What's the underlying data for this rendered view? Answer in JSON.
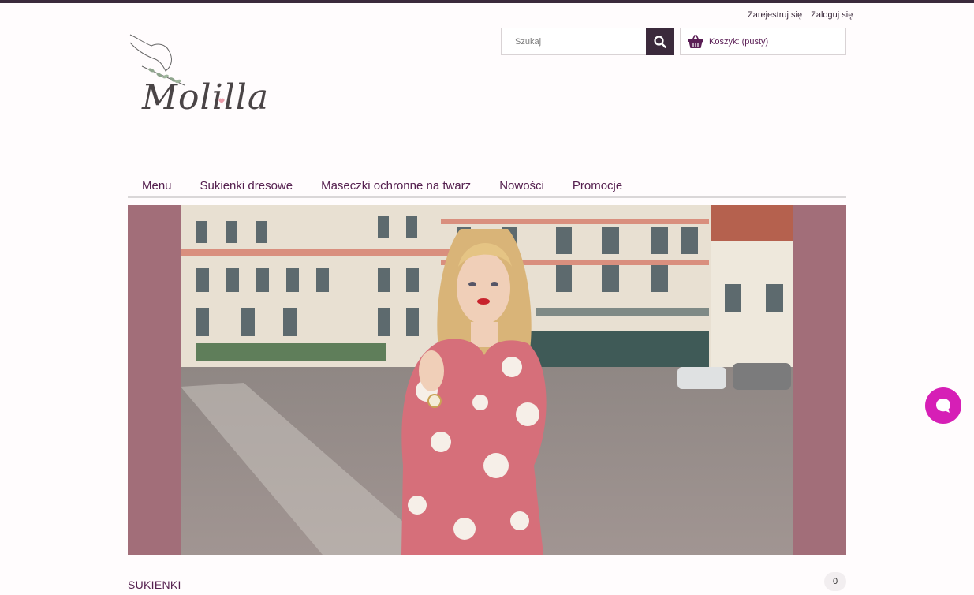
{
  "header": {
    "register_label": "Zarejestruj się",
    "login_label": "Zaloguj się",
    "logo_text": "Molilla",
    "search": {
      "placeholder": "Szukaj",
      "value": ""
    },
    "cart_label": "Koszyk: (pusty)"
  },
  "nav": {
    "items": [
      {
        "label": "Menu"
      },
      {
        "label": "Sukienki dresowe"
      },
      {
        "label": "Maseczki ochronne na twarz"
      },
      {
        "label": "Nowości"
      },
      {
        "label": "Promocje"
      }
    ]
  },
  "banner": {
    "side_color": "#a26e79"
  },
  "section": {
    "title": "SUKIENKI",
    "count": "0"
  },
  "colors": {
    "accent": "#3b2a3c",
    "link": "#55204f",
    "chat": "#d61fb6"
  },
  "icons": [
    "search-icon",
    "basket-icon",
    "chat-icon"
  ]
}
